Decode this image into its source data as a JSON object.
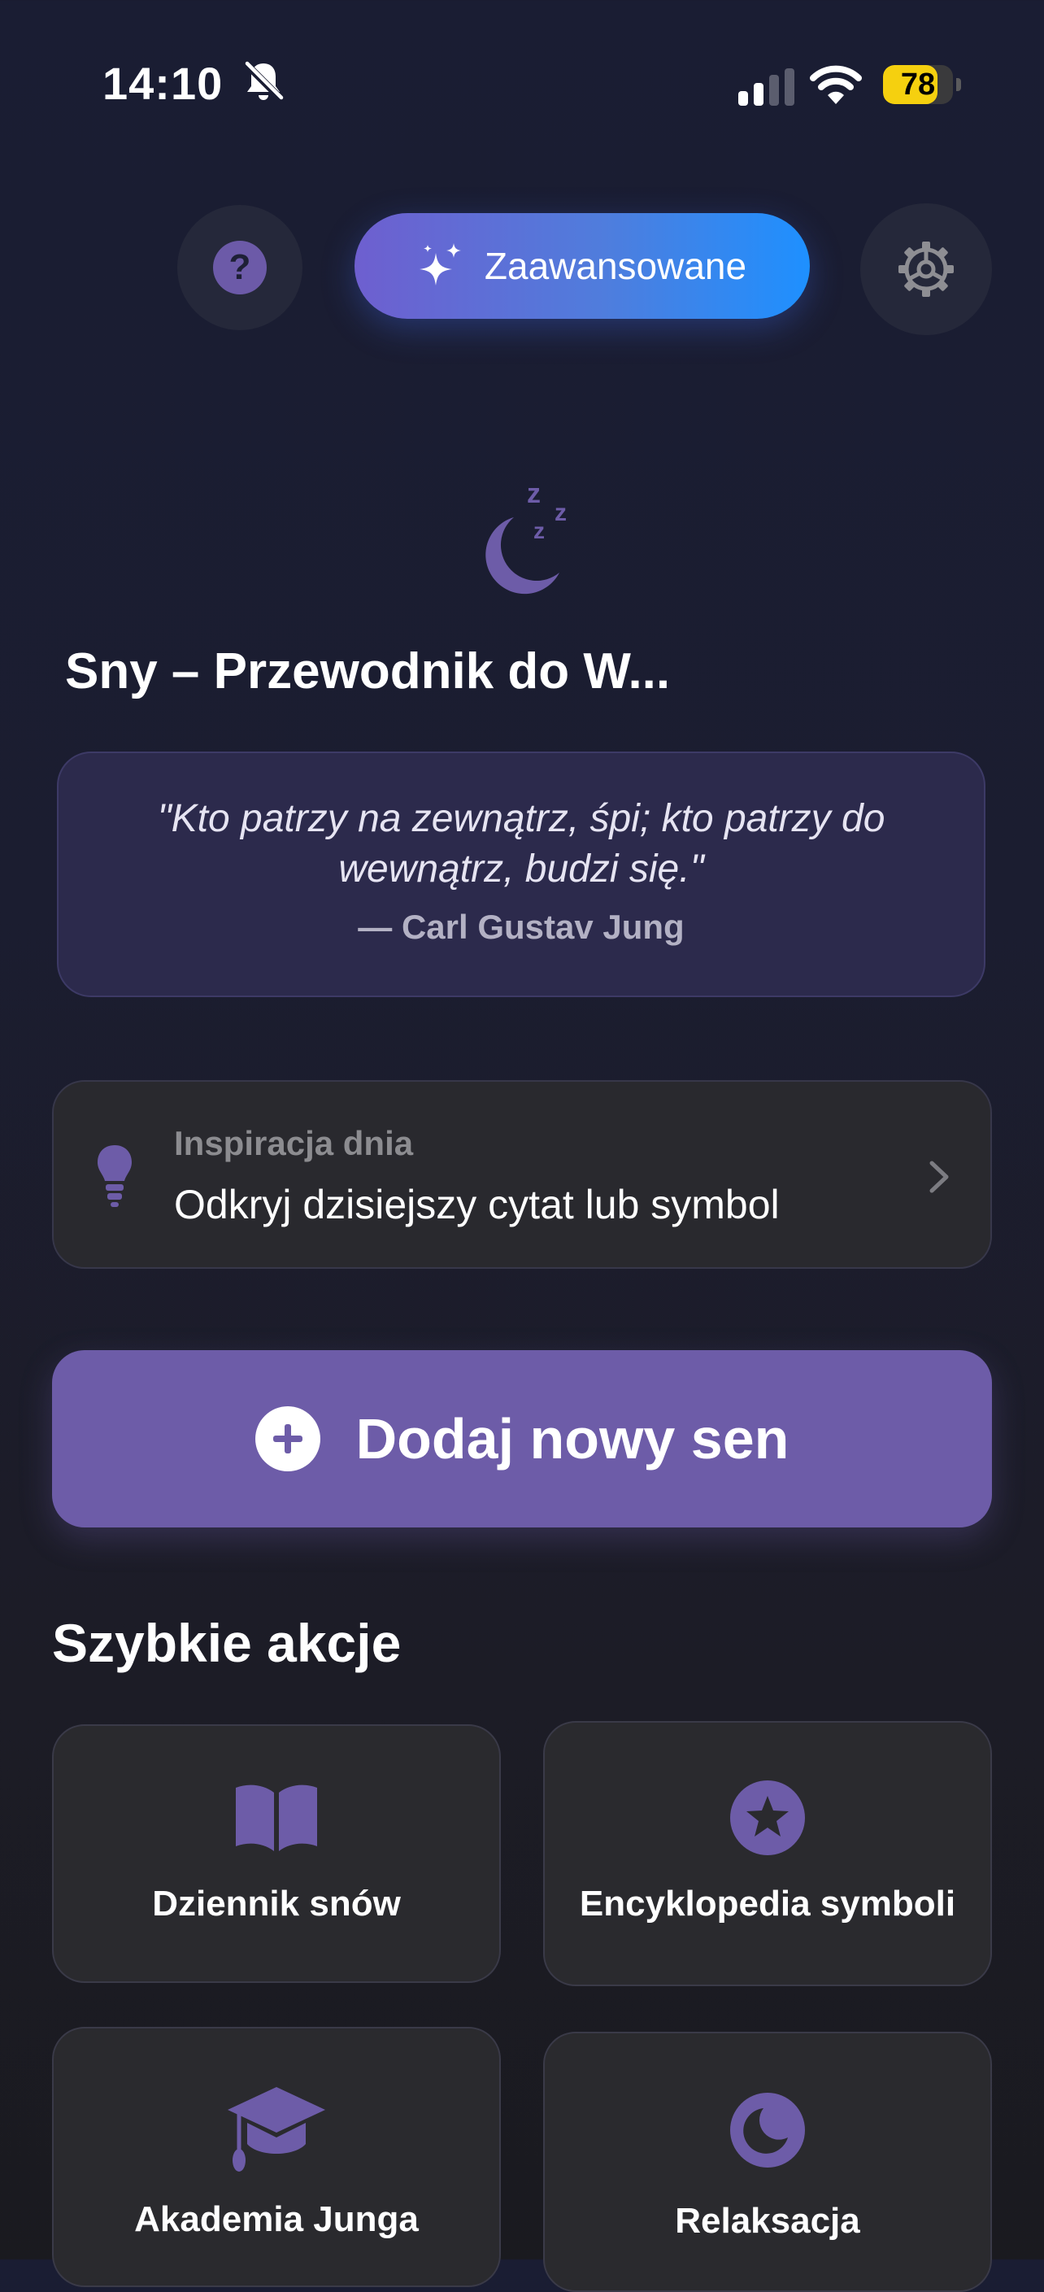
{
  "status_bar": {
    "time": "14:10",
    "battery_level": "78",
    "battery_fraction": 0.78,
    "icons": [
      "bell-muted-icon",
      "cellular-signal-icon",
      "wifi-icon",
      "battery-icon"
    ]
  },
  "top_bar": {
    "help_icon": "question-icon",
    "help_symbol": "?",
    "advanced_label": "Zaawansowane",
    "advanced_icon": "sparkles-icon",
    "settings_icon": "gear-icon"
  },
  "hero": {
    "icon": "sleeping-moon-icon",
    "title": "Sny – Przewodnik do W..."
  },
  "quote": {
    "text": "\"Kto patrzy na zewnątrz, śpi; kto patrzy do wewnątrz, budzi się.\"",
    "author": "— Carl Gustav Jung"
  },
  "inspiration": {
    "icon": "lightbulb-icon",
    "label": "Inspiracja dnia",
    "text": "Odkryj dzisiejszy cytat lub symbol"
  },
  "add_dream": {
    "label": "Dodaj nowy sen",
    "icon": "plus-circle-icon"
  },
  "quick_actions": {
    "title": "Szybkie akcje",
    "tiles": [
      {
        "label": "Dziennik snów",
        "icon": "book-icon"
      },
      {
        "label": "Encyklopedia symboli",
        "icon": "star-circle-icon"
      },
      {
        "label": "Akademia Junga",
        "icon": "graduation-cap-icon"
      },
      {
        "label": "Relaksacja",
        "icon": "moon-circle-icon"
      }
    ]
  },
  "colors": {
    "accent": "#6d5ca8",
    "background": "#1a1d33",
    "battery": "#f5d00f",
    "gradient_end": "#1e90ff"
  }
}
